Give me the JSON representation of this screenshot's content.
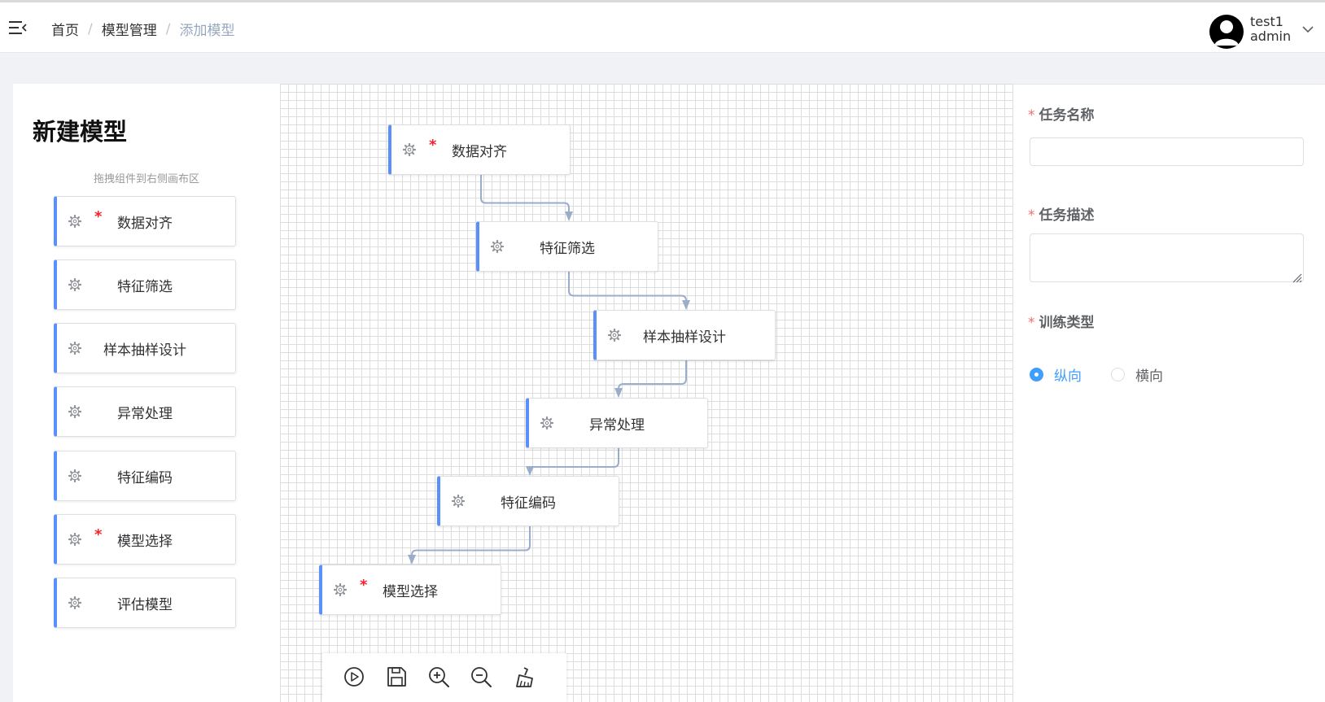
{
  "breadcrumb": {
    "home": "首页",
    "model_mgmt": "模型管理",
    "current": "添加模型",
    "separator": "/"
  },
  "user": {
    "name": "test1",
    "role": "admin"
  },
  "left_panel": {
    "title": "新建模型",
    "hint": "拖拽组件到右侧画布区",
    "items": [
      {
        "label": "数据对齐",
        "required": "*"
      },
      {
        "label": "特征筛选",
        "required": ""
      },
      {
        "label": "样本抽样设计",
        "required": ""
      },
      {
        "label": "异常处理",
        "required": ""
      },
      {
        "label": "特征编码",
        "required": ""
      },
      {
        "label": "模型选择",
        "required": "*"
      },
      {
        "label": "评估模型",
        "required": ""
      }
    ]
  },
  "canvas": {
    "nodes": [
      {
        "label": "数据对齐",
        "required": "*"
      },
      {
        "label": "特征筛选",
        "required": ""
      },
      {
        "label": "样本抽样设计",
        "required": ""
      },
      {
        "label": "异常处理",
        "required": ""
      },
      {
        "label": "特征编码",
        "required": ""
      },
      {
        "label": "模型选择",
        "required": "*"
      }
    ],
    "toolbar": [
      "play-icon",
      "save-icon",
      "zoom-in-icon",
      "zoom-out-icon",
      "clear-icon"
    ]
  },
  "form": {
    "task_name": {
      "label": "任务名称",
      "value": "",
      "required": "*"
    },
    "task_desc": {
      "label": "任务描述",
      "value": "",
      "required": "*"
    },
    "train_type": {
      "label": "训练类型",
      "required": "*",
      "options": [
        {
          "label": "纵向",
          "checked": true
        },
        {
          "label": "横向",
          "checked": false
        }
      ]
    }
  },
  "colors": {
    "accent": "#409eff",
    "node_border": "#5b8ff9",
    "required": "#f5222d",
    "edge": "#9aaecb"
  }
}
